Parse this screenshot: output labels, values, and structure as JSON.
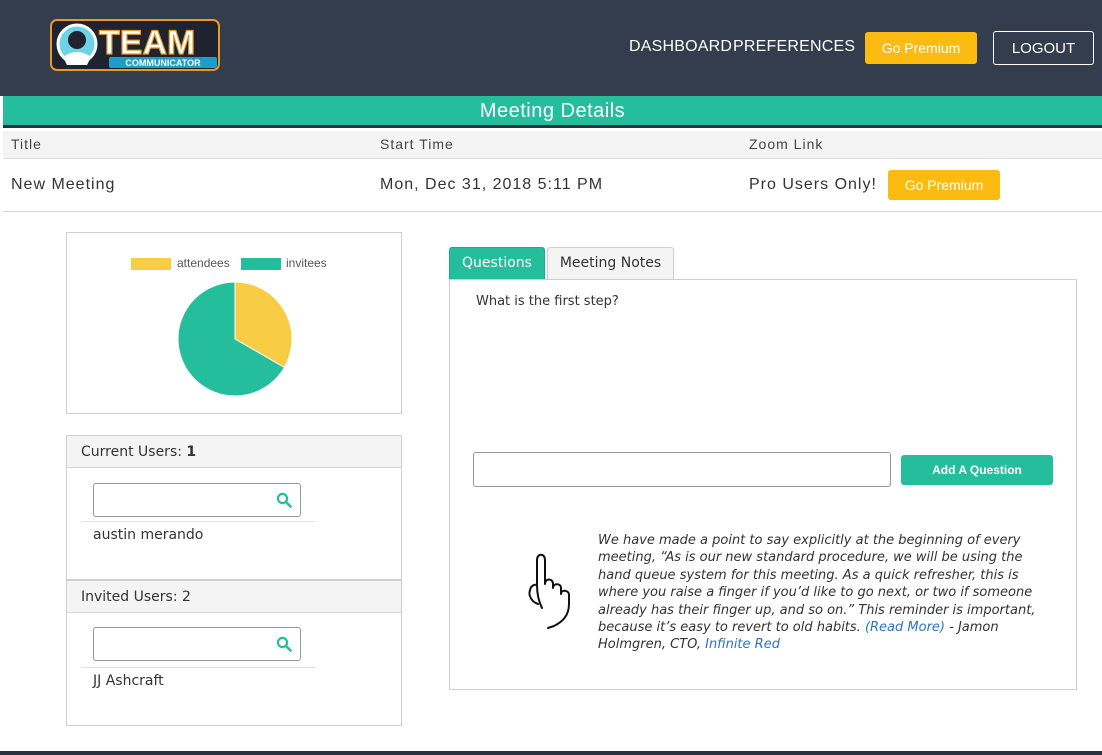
{
  "header": {
    "logo_text": "TEAM",
    "logo_subtext": "COMMUNICATOR",
    "nav": {
      "dashboard": "DASHBOARD",
      "preferences": "PREFERENCES"
    },
    "go_premium_label": "Go Premium",
    "logout_label": "LOGOUT"
  },
  "meeting": {
    "heading": "Meeting Details",
    "columns": {
      "title": "Title",
      "start_time": "Start Time",
      "zoom_link": "Zoom Link"
    },
    "row": {
      "title": "New Meeting",
      "start_time": "Mon, Dec 31, 2018 5:11 PM",
      "zoom_link_text": "Pro Users Only!",
      "zoom_button_label": "Go Premium"
    }
  },
  "chart_data": {
    "type": "pie",
    "categories": [
      "attendees",
      "invitees"
    ],
    "values": [
      1,
      2
    ],
    "colors": [
      "#f9cc45",
      "#25be9d"
    ],
    "legend_position": "top"
  },
  "current_users": {
    "label": "Current Users:",
    "count": "1",
    "search_placeholder": "",
    "users": [
      "austin merando"
    ]
  },
  "invited_users": {
    "label": "Invited Users:",
    "count": "2",
    "search_placeholder": "",
    "users": [
      "JJ Ashcraft"
    ]
  },
  "tabs": {
    "questions": "Questions",
    "notes": "Meeting Notes"
  },
  "questions": {
    "items": [
      "What is the first step?"
    ],
    "input_placeholder": "",
    "add_label": "Add A Question"
  },
  "quote": {
    "text": "We have made a point to say explicitly at the beginning of every meeting, “As is our new standard procedure, we will be using the hand queue system for this meeting. As a quick refresher, this is where you raise a finger if you’d like to go next, or two if someone already has their finger up, and so on.” This reminder is important, because it’s easy to revert to old habits.",
    "read_more": "(Read More)",
    "dash": " -",
    "attribution": "Jamon Holmgren, CTO,",
    "company": "Infinite Red"
  },
  "colors": {
    "header_bg": "#333d4e",
    "accent": "#25be9d",
    "premium": "#fbbb10",
    "attendees": "#f9cc45"
  }
}
